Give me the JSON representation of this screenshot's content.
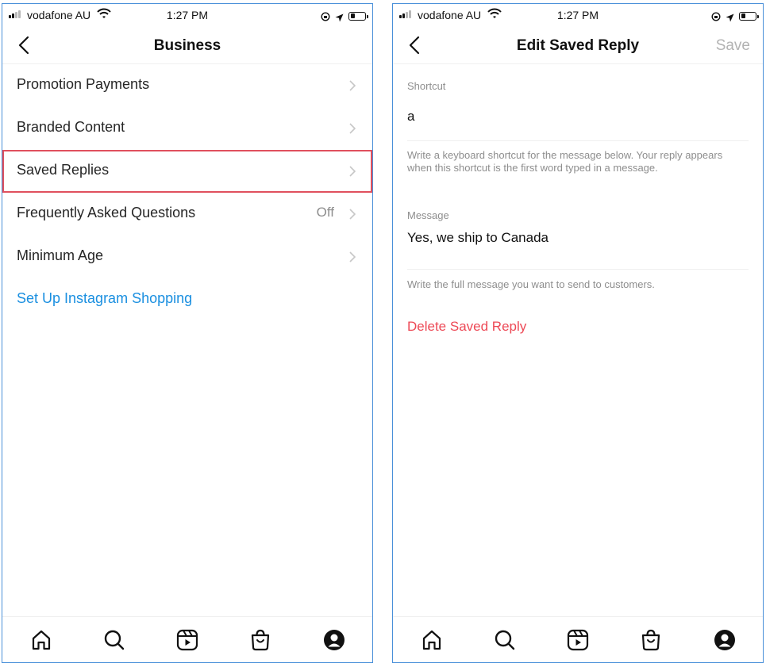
{
  "status_bar": {
    "carrier": "vodafone AU",
    "time": "1:27 PM"
  },
  "left_screen": {
    "title": "Business",
    "items": [
      {
        "label": "Promotion Payments",
        "value": ""
      },
      {
        "label": "Branded Content",
        "value": ""
      },
      {
        "label": "Saved Replies",
        "value": ""
      },
      {
        "label": "Frequently Asked Questions",
        "value": "Off"
      },
      {
        "label": "Minimum Age",
        "value": ""
      }
    ],
    "link": "Set Up Instagram Shopping"
  },
  "right_screen": {
    "title": "Edit Saved Reply",
    "save_label": "Save",
    "shortcut_label": "Shortcut",
    "shortcut_value": "a",
    "shortcut_help": "Write a keyboard shortcut for the message below. Your reply appears when this shortcut is the first word typed in a message.",
    "message_label": "Message",
    "message_value": "Yes, we ship to Canada",
    "message_help": "Write the full message you want to send to customers.",
    "delete_label": "Delete Saved Reply"
  },
  "tab_bar": {
    "icons": [
      "home-icon",
      "search-icon",
      "reels-icon",
      "shop-icon",
      "profile-icon"
    ]
  },
  "colors": {
    "link_blue": "#1a8fe0",
    "delete_red": "#ed4956",
    "highlight_border": "#e0505e",
    "frame_border": "#4a90d9",
    "muted_text": "#8e8e8e"
  }
}
